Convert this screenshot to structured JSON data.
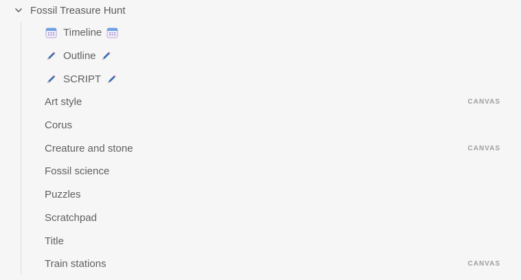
{
  "folder": {
    "title": "Fossil Treasure Hunt",
    "icon": "chevron-down-icon",
    "expanded": true
  },
  "items": [
    {
      "label": "Timeline",
      "lead_icon": "calendar-icon",
      "trail_icon": "calendar-icon",
      "badge": ""
    },
    {
      "label": "Outline",
      "lead_icon": "pencil-icon",
      "trail_icon": "pencil-icon",
      "badge": ""
    },
    {
      "label": "SCRIPT",
      "lead_icon": "pencil-icon",
      "trail_icon": "pencil-icon",
      "badge": ""
    },
    {
      "label": "Art style",
      "badge": "CANVAS"
    },
    {
      "label": "Corus",
      "badge": ""
    },
    {
      "label": "Creature and stone",
      "badge": "CANVAS"
    },
    {
      "label": "Fossil science",
      "badge": ""
    },
    {
      "label": "Puzzles",
      "badge": ""
    },
    {
      "label": "Scratchpad",
      "badge": ""
    },
    {
      "label": "Title",
      "badge": ""
    },
    {
      "label": "Train stations",
      "badge": "CANVAS"
    }
  ],
  "colors": {
    "background": "#f6f6f6",
    "text": "#5f5f5f",
    "badge": "#9d9d9d",
    "guide": "#dedede"
  }
}
